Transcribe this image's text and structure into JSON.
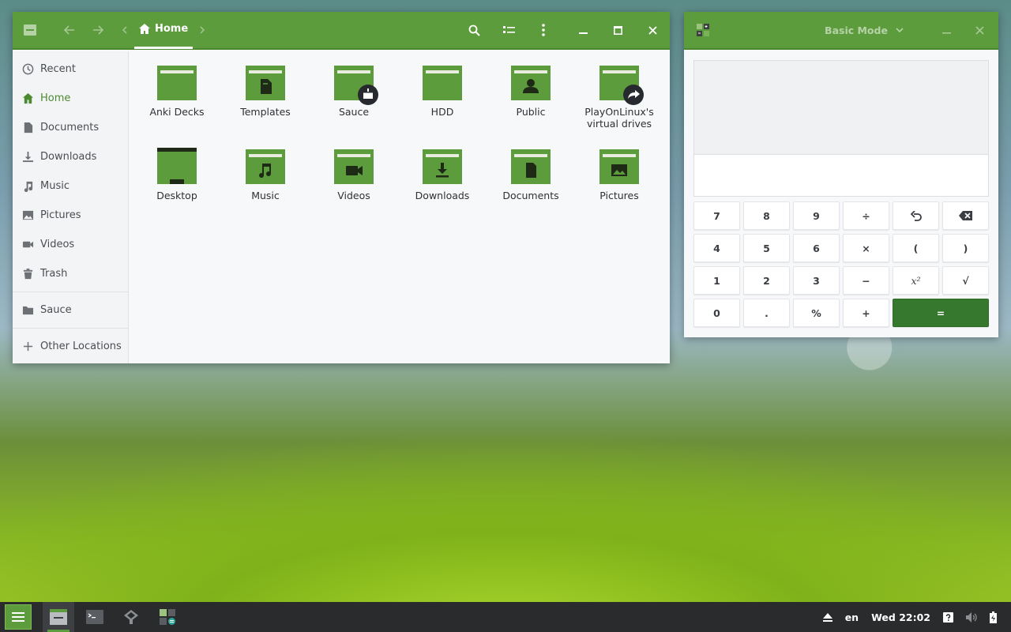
{
  "files_window": {
    "location_label": "Home",
    "sidebar": [
      {
        "label": "Recent",
        "icon": "clock-icon"
      },
      {
        "label": "Home",
        "icon": "home-icon",
        "active": true
      },
      {
        "label": "Documents",
        "icon": "document-icon"
      },
      {
        "label": "Downloads",
        "icon": "download-icon"
      },
      {
        "label": "Music",
        "icon": "music-icon"
      },
      {
        "label": "Pictures",
        "icon": "image-icon"
      },
      {
        "label": "Videos",
        "icon": "video-icon"
      },
      {
        "label": "Trash",
        "icon": "trash-icon"
      },
      {
        "label": "Sauce",
        "icon": "folder-icon"
      },
      {
        "label": "Other Locations",
        "icon": "plus-icon"
      }
    ],
    "items": [
      {
        "label": "Anki Decks",
        "emblem": "none"
      },
      {
        "label": "Templates",
        "emblem": "template"
      },
      {
        "label": "Sauce",
        "emblem": "package"
      },
      {
        "label": "HDD",
        "emblem": "none"
      },
      {
        "label": "Public",
        "emblem": "user"
      },
      {
        "label": "PlayOnLinux's virtual drives",
        "emblem": "symlink"
      },
      {
        "label": "Desktop",
        "emblem": "desktop"
      },
      {
        "label": "Music",
        "emblem": "music"
      },
      {
        "label": "Videos",
        "emblem": "video"
      },
      {
        "label": "Downloads",
        "emblem": "download"
      },
      {
        "label": "Documents",
        "emblem": "document"
      },
      {
        "label": "Pictures",
        "emblem": "image"
      }
    ]
  },
  "calculator": {
    "mode_label": "Basic Mode",
    "keys": [
      [
        "7",
        "8",
        "9",
        "÷",
        "undo",
        "backspace"
      ],
      [
        "4",
        "5",
        "6",
        "×",
        "(",
        ")"
      ],
      [
        "1",
        "2",
        "3",
        "−",
        "x²",
        "√"
      ],
      [
        "0",
        ".",
        "%",
        "+",
        "="
      ]
    ]
  },
  "taskbar": {
    "keyboard_layout": "en",
    "clock": "Wed 22:02"
  },
  "colors": {
    "accent": "#5c9c3c",
    "accent_dark": "#37782f",
    "folder": "#5c9c3c",
    "folder_tab": "#e8ecdf"
  }
}
